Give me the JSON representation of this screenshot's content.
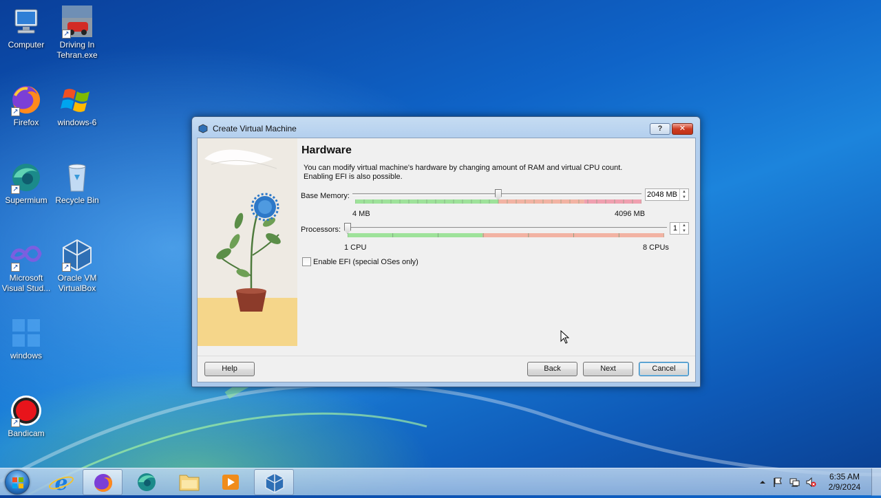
{
  "desktop": {
    "icons": [
      {
        "label": "Computer",
        "shortcut": false
      },
      {
        "label": "Driving In Tehran.exe",
        "shortcut": true
      },
      {
        "label": "Firefox",
        "shortcut": true
      },
      {
        "label": "windows-6",
        "shortcut": false
      },
      {
        "label": "Supermium",
        "shortcut": true
      },
      {
        "label": "Recycle Bin",
        "shortcut": false
      },
      {
        "label": "Microsoft Visual Stud...",
        "shortcut": true
      },
      {
        "label": "Oracle VM VirtualBox",
        "shortcut": true
      },
      {
        "label": "windows",
        "shortcut": false
      },
      {
        "label": "Bandicam",
        "shortcut": true
      }
    ]
  },
  "dialog": {
    "title": "Create Virtual Machine",
    "help_glyph": "?",
    "close_glyph": "✕",
    "heading": "Hardware",
    "description_line1": "You can modify virtual machine's hardware by changing amount of RAM and virtual CPU count.",
    "description_line2": "Enabling EFI is also possible.",
    "memory": {
      "label": "Base Memory:",
      "value": 2048,
      "value_text": "2048 MB",
      "min": 4,
      "max": 4096,
      "min_label": "4 MB",
      "max_label": "4096 MB"
    },
    "processors": {
      "label": "Processors:",
      "value": 1,
      "value_text": "1",
      "min": 1,
      "max": 8,
      "min_label": "1 CPU",
      "max_label": "8 CPUs"
    },
    "efi": {
      "label": "Enable EFI (special OSes only)",
      "checked": false
    },
    "buttons": {
      "help": "Help",
      "back": "Back",
      "next": "Next",
      "cancel": "Cancel"
    }
  },
  "taskbar": {
    "pinned": [
      "internet-explorer",
      "firefox",
      "supermium",
      "file-explorer",
      "media-player",
      "virtualbox"
    ],
    "active": [
      "firefox",
      "virtualbox"
    ],
    "clock_time": "6:35 AM",
    "clock_date": "2/9/2024"
  },
  "colors": {
    "ok_range": "#9ee29a",
    "warn_range": "#f2b3a3",
    "bad_range": "#f0a0b0",
    "default_button_border": "#3c7fb1"
  }
}
